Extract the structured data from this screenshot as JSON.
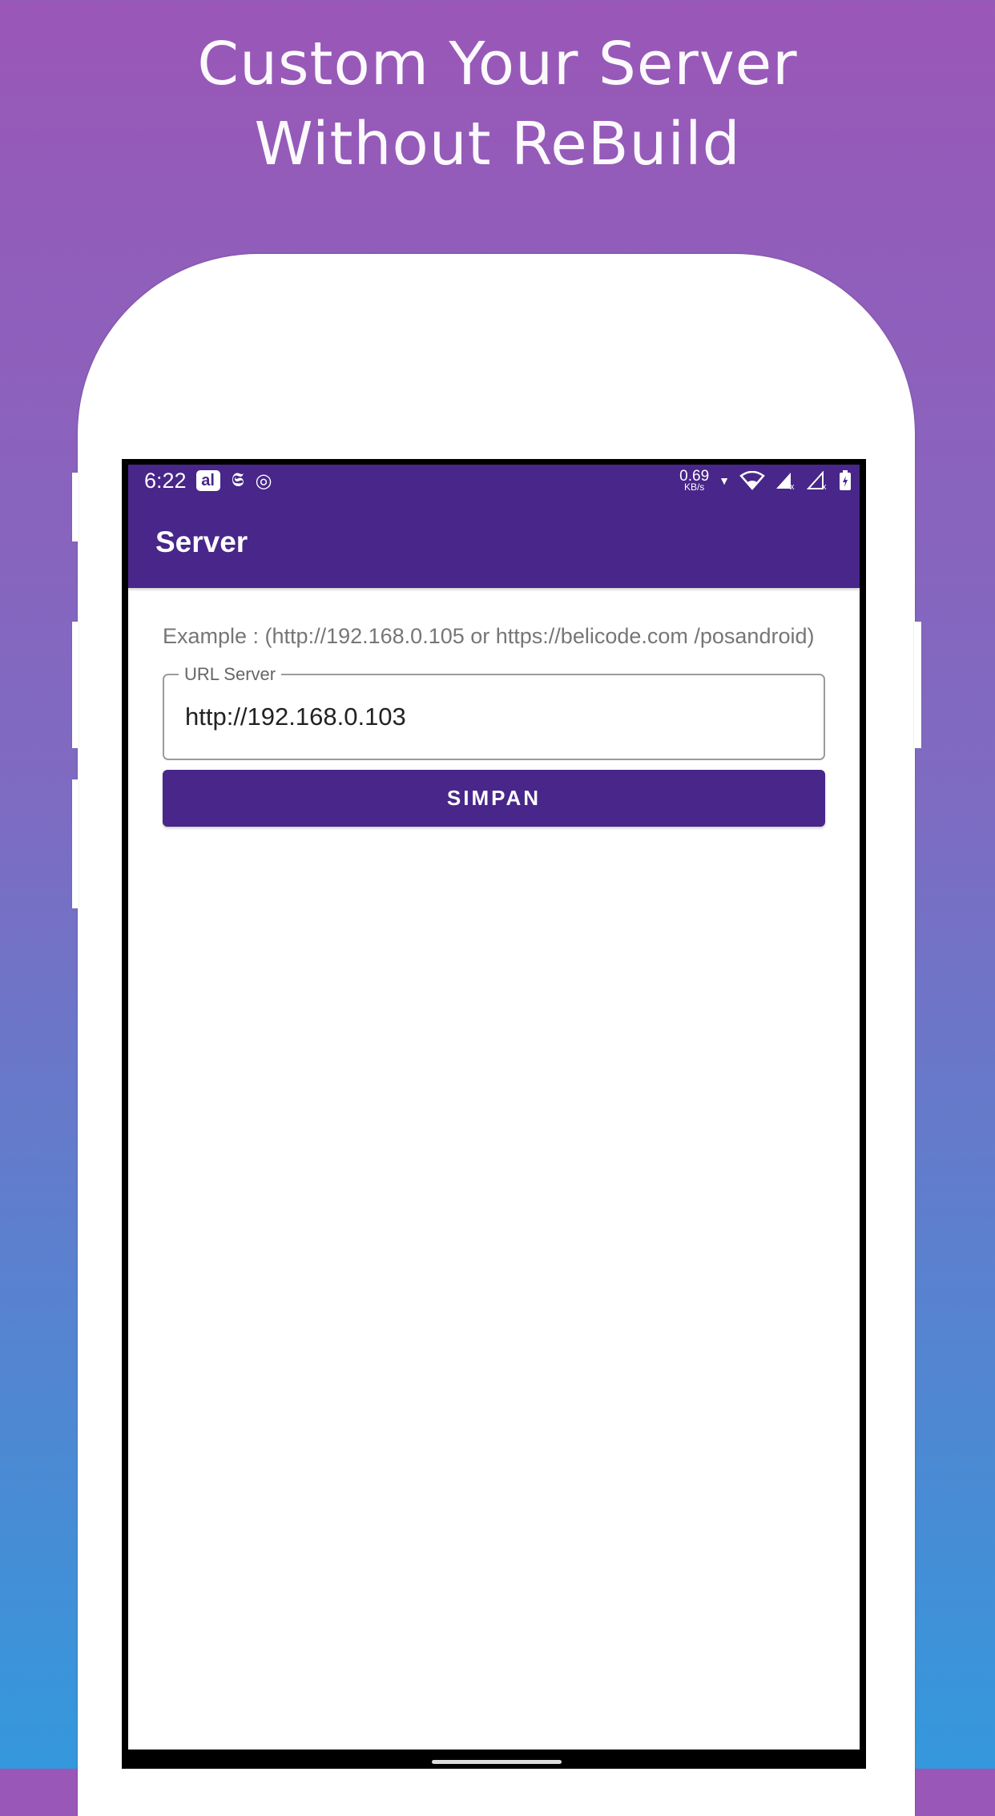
{
  "headline": {
    "line1": "Custom Your Server",
    "line2": "Without ReBuild"
  },
  "status_bar": {
    "time": "6:22",
    "speed_value": "0.69",
    "speed_unit": "KB/s",
    "icons": [
      "ai-notification-icon",
      "app-notification-icon",
      "vpn-icon",
      "data-arrow-icon",
      "wifi-icon",
      "signal-no-sim-icon",
      "signal-no-sim-icon",
      "battery-charging-icon"
    ]
  },
  "app_bar": {
    "title": "Server"
  },
  "form": {
    "hint": "Example : (http://192.168.0.105 or https://belicode.com /posandroid)",
    "url_label": "URL Server",
    "url_value": "http://192.168.0.103",
    "save_label": "SIMPAN"
  },
  "colors": {
    "primary": "#48268a",
    "gradient_top": "#9a57b7",
    "gradient_bottom": "#3498dc"
  }
}
